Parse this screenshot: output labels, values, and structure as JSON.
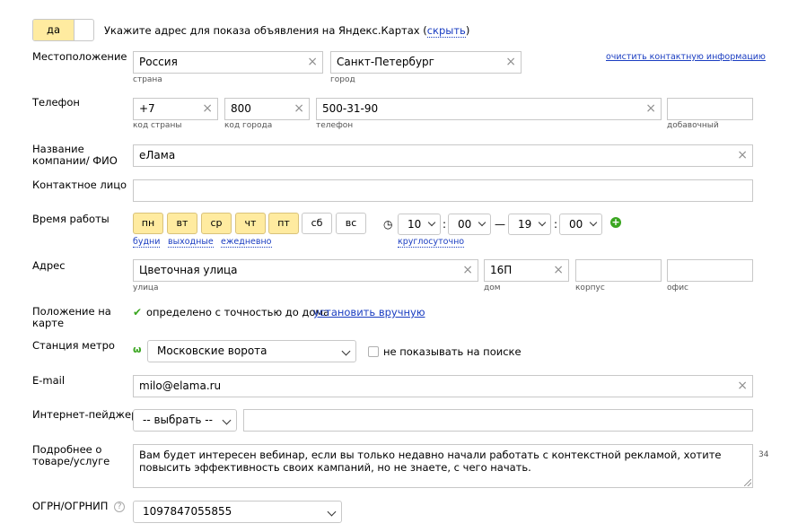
{
  "toggle": {
    "on_label": "да"
  },
  "banner": {
    "text": "Укажите адрес для показа объявления на Яндекс.Картах (",
    "link": "скрыть",
    "close_paren": ")"
  },
  "location": {
    "label": "Местоположение",
    "country": "Россия",
    "country_sub": "страна",
    "city": "Санкт-Петербург",
    "city_sub": "город",
    "clear_link": "очистить контактную информацию"
  },
  "phone": {
    "label": "Телефон",
    "country_code": "+7",
    "country_code_sub": "код страны",
    "city_code": "800",
    "city_code_sub": "код города",
    "number": "500-31-90",
    "number_sub": "телефон",
    "ext": "",
    "ext_sub": "добавочный"
  },
  "company": {
    "label": "Название компании/ ФИО",
    "value": "eЛама"
  },
  "contact": {
    "label": "Контактное лицо",
    "value": ""
  },
  "hours": {
    "label": "Время работы",
    "days": [
      {
        "label": "пн",
        "on": true
      },
      {
        "label": "вт",
        "on": true
      },
      {
        "label": "ср",
        "on": true
      },
      {
        "label": "чт",
        "on": true
      },
      {
        "label": "пт",
        "on": true
      },
      {
        "label": "сб",
        "on": false
      },
      {
        "label": "вс",
        "on": false
      }
    ],
    "preset_weekdays": "будни",
    "preset_weekend": "выходные",
    "preset_daily": "ежедневно",
    "from_h": "10",
    "from_m": "00",
    "to_h": "19",
    "to_m": "00",
    "colon": ":",
    "dash": "—",
    "allday": "круглосуточно"
  },
  "address": {
    "label": "Адрес",
    "street": "Цветочная улица",
    "street_sub": "улица",
    "house": "16П",
    "house_sub": "дом",
    "building": "",
    "building_sub": "корпус",
    "office": "",
    "office_sub": "офис"
  },
  "map_position": {
    "label": "Положение на карте",
    "status": "определено с точностью до дома",
    "manual_link": "установить вручную"
  },
  "metro": {
    "label": "Станция метро",
    "value": "Московские ворота",
    "hide_label": "не показывать на поиске"
  },
  "email": {
    "label": "E-mail",
    "value": "milo@elama.ru"
  },
  "pager": {
    "label": "Интернет-пейджер",
    "select": "-- выбрать --",
    "value": ""
  },
  "details": {
    "label": "Подробнее о товаре/услуге",
    "value": "Вам будет интересен вебинар, если вы только недавно начали работать с контекстной рекламой, хотите повысить эффективность своих кампаний, но не знаете, с чего начать.",
    "counter": "34"
  },
  "ogrn": {
    "label": "ОГРН/ОГРНИП",
    "help": "?",
    "value": "1097847055855"
  },
  "glyphs": {
    "clear": "×",
    "check": "✔",
    "clock": "◷",
    "plus": "+",
    "metro": "ω"
  },
  "colors": {
    "accent_yellow": "#ffeba0",
    "link_blue": "#1a3dc1",
    "check_green": "#3aa620",
    "metro_green": "#3aa620"
  }
}
